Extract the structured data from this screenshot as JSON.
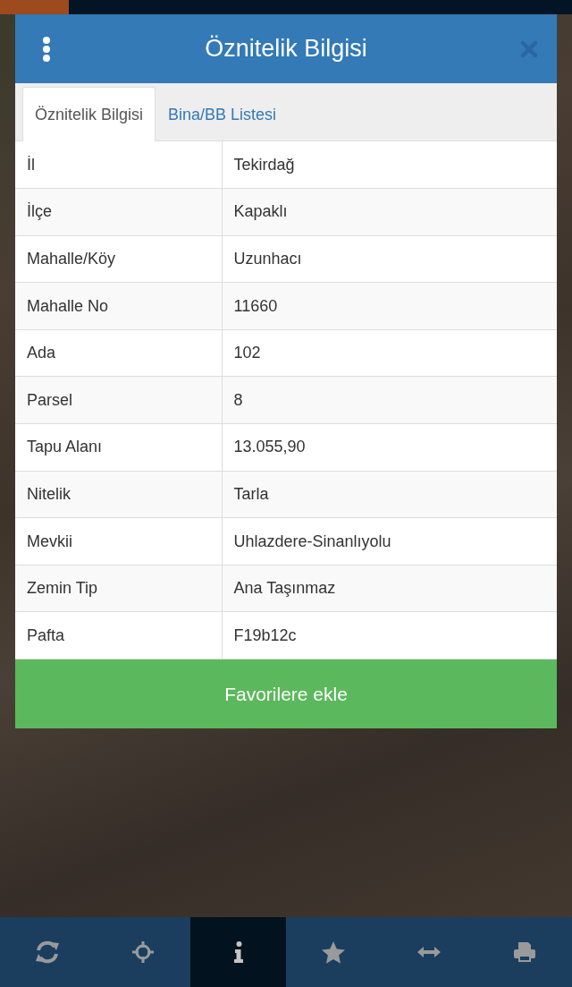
{
  "header": {
    "title": "Öznitelik Bilgisi"
  },
  "tabs": [
    {
      "label": "Öznitelik Bilgisi",
      "selected": true
    },
    {
      "label": "Bina/BB Listesi",
      "selected": false
    }
  ],
  "attributes": [
    {
      "label": "İl",
      "value": "Tekirdağ"
    },
    {
      "label": "İlçe",
      "value": "Kapaklı"
    },
    {
      "label": "Mahalle/Köy",
      "value": "Uzunhacı"
    },
    {
      "label": "Mahalle No",
      "value": "11660"
    },
    {
      "label": "Ada",
      "value": "102"
    },
    {
      "label": "Parsel",
      "value": "8"
    },
    {
      "label": "Tapu Alanı",
      "value": "13.055,90"
    },
    {
      "label": "Nitelik",
      "value": "Tarla"
    },
    {
      "label": "Mevkii",
      "value": "Uhlazdere-Sinanlıyolu"
    },
    {
      "label": "Zemin Tip",
      "value": "Ana Taşınmaz"
    },
    {
      "label": "Pafta",
      "value": "F19b12c"
    }
  ],
  "favorite_button": {
    "label": "Favorilere ekle"
  },
  "toolbar": [
    {
      "kind": "refresh",
      "selected": false
    },
    {
      "kind": "locate",
      "selected": false
    },
    {
      "kind": "info",
      "selected": true
    },
    {
      "kind": "favorite",
      "selected": false
    },
    {
      "kind": "measure",
      "selected": false
    },
    {
      "kind": "print",
      "selected": false
    }
  ]
}
